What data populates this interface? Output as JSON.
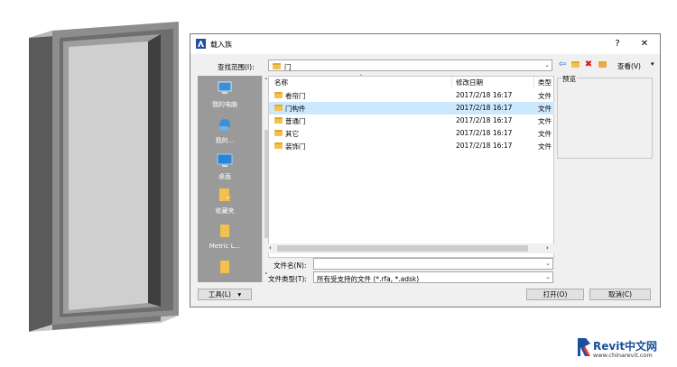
{
  "dialog": {
    "title": "载入族",
    "help_label": "?",
    "close_label": "✕"
  },
  "lookin": {
    "label": "查找范围(I):",
    "value": "门"
  },
  "toolbar": {
    "view_label": "查看(V)"
  },
  "places": [
    {
      "label": "我的电脑",
      "icon": "computer-icon"
    },
    {
      "label": "我的...",
      "icon": "network-icon"
    },
    {
      "label": "桌面",
      "icon": "desktop-icon"
    },
    {
      "label": "收藏夹",
      "icon": "favorites-icon"
    },
    {
      "label": "Metric L...",
      "icon": "folder-icon"
    }
  ],
  "columns": {
    "name": "名称",
    "date": "修改日期",
    "type": "类型"
  },
  "files": [
    {
      "name": "卷帘门",
      "date": "2017/2/18 16:17",
      "type": "文件"
    },
    {
      "name": "门构件",
      "date": "2017/2/18 16:17",
      "type": "文件",
      "selected": true
    },
    {
      "name": "普通门",
      "date": "2017/2/18 16:17",
      "type": "文件"
    },
    {
      "name": "其它",
      "date": "2017/2/18 16:17",
      "type": "文件"
    },
    {
      "name": "装饰门",
      "date": "2017/2/18 16:17",
      "type": "文件"
    }
  ],
  "preview_label": "预览",
  "filename": {
    "label": "文件名(N):",
    "value": ""
  },
  "filetype": {
    "label": "文件类型(T):",
    "value": "所有受支持的文件 (*.rfa, *.adsk)"
  },
  "buttons": {
    "tools": "工具(L)",
    "open": "打开(O)",
    "cancel": "取消(C)"
  },
  "watermark": {
    "brand": "Revit中文网",
    "url": "www.chinarevit.com"
  },
  "colors": {
    "selection": "#cce8ff",
    "places_bg": "#9a9a9a",
    "brand": "#1a4f9c"
  }
}
